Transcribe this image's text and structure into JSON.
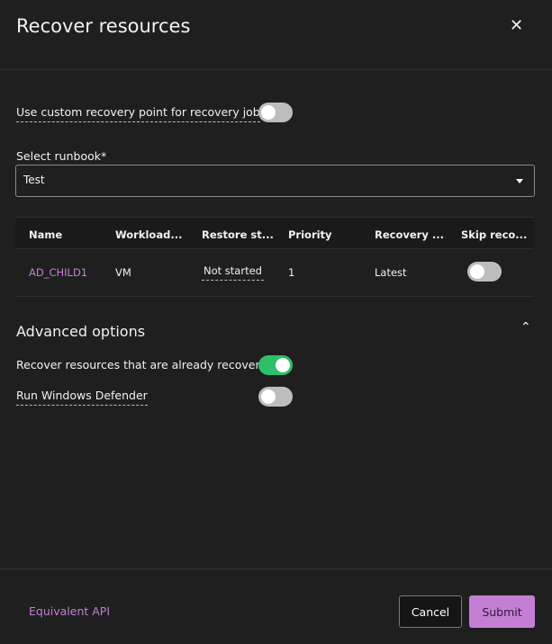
{
  "header": {
    "title": "Recover resources",
    "close_icon": "close-icon"
  },
  "custom_point": {
    "label": "Use custom recovery point for recovery job",
    "enabled": false
  },
  "runbook": {
    "label": "Select runbook",
    "required": "*",
    "value": "Test"
  },
  "table": {
    "columns": [
      "Name",
      "Workload...",
      "Restore st...",
      "Priority",
      "Recovery ...",
      "Skip reco..."
    ],
    "rows": [
      {
        "name": "AD_CHILD1",
        "workload": "VM",
        "restore_status": "Not started",
        "priority": "1",
        "recovery": "Latest",
        "skip": false
      }
    ]
  },
  "advanced": {
    "title": "Advanced options",
    "recover_already": {
      "label": "Recover resources that are already recovered",
      "enabled": true
    },
    "defender": {
      "label": "Run Windows Defender",
      "enabled": false
    }
  },
  "footer": {
    "api_link": "Equivalent API",
    "cancel": "Cancel",
    "submit": "Submit"
  },
  "colors": {
    "accent": "#c47fd5",
    "toggle_on": "#2dbf6a"
  }
}
